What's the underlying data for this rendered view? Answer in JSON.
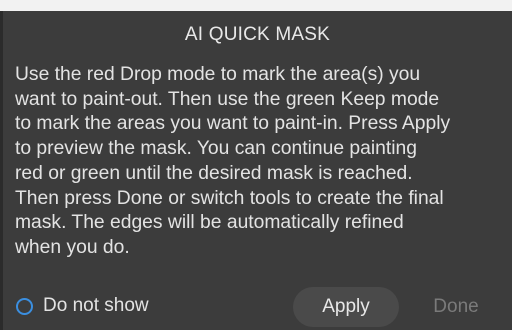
{
  "dialog": {
    "title": "AI QUICK MASK",
    "instructions": "Use the red Drop mode to mark the area(s) you\nwant to paint-out. Then use the green Keep mode\nto mark the areas you want to paint-in. Press Apply\nto preview the mask. You can continue painting\nred or green until the desired mask is reached.\nThen press Done or switch tools to create the final\nmask. The edges will be automatically refined\nwhen you do."
  },
  "footer": {
    "do_not_show_label": "Do not show",
    "apply_label": "Apply",
    "done_label": "Done"
  },
  "colors": {
    "dialog_background": "#3c3c3c",
    "accent": "#3b8fe0",
    "disabled_text": "#7a7a7a"
  }
}
